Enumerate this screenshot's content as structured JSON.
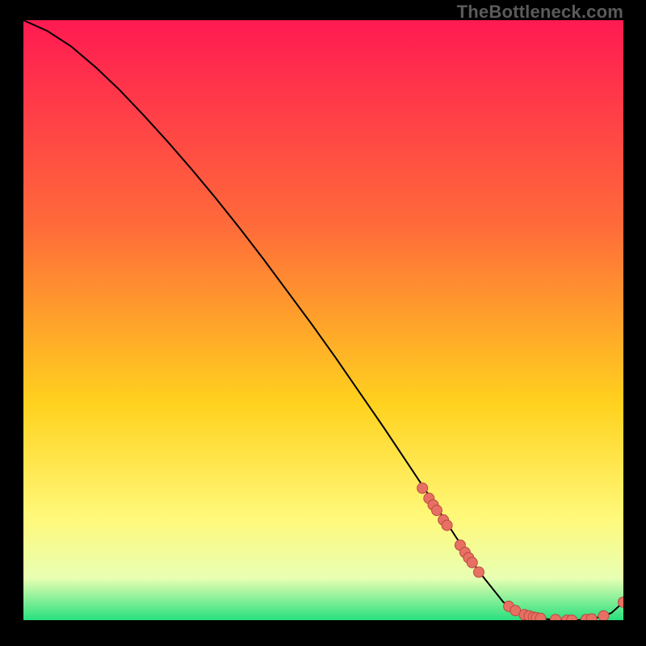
{
  "watermark": "TheBottleneck.com",
  "colors": {
    "black": "#000000",
    "gradient_top": "#ff1a52",
    "gradient_mid1": "#ff6a3a",
    "gradient_mid2": "#ffd21e",
    "gradient_mid3": "#fff97a",
    "gradient_mid4": "#e8ffb3",
    "gradient_bottom": "#28e07f",
    "line": "#000000",
    "point_fill": "#e77063",
    "point_stroke": "#b84b42"
  },
  "chart_data": {
    "type": "line",
    "title": "",
    "xlabel": "",
    "ylabel": "",
    "xlim": [
      0,
      100
    ],
    "ylim": [
      0,
      100
    ],
    "series": [
      {
        "name": "curve",
        "x": [
          0,
          4,
          8,
          12,
          16,
          20,
          24,
          28,
          32,
          36,
          40,
          44,
          48,
          52,
          56,
          60,
          64,
          68,
          72,
          76,
          80,
          83,
          86,
          88,
          90,
          92,
          94,
          96,
          98,
          100
        ],
        "y": [
          100,
          98.2,
          95.6,
          92.2,
          88.4,
          84.2,
          79.8,
          75.2,
          70.4,
          65.4,
          60.2,
          54.8,
          49.4,
          43.8,
          38.0,
          32.2,
          26.2,
          20.2,
          14.0,
          8.0,
          3.0,
          1.2,
          0.3,
          0.1,
          0.0,
          0.0,
          0.1,
          0.5,
          1.2,
          3.0
        ]
      }
    ],
    "points": [
      {
        "x": 66.5,
        "y": 22.0
      },
      {
        "x": 67.6,
        "y": 20.3
      },
      {
        "x": 68.3,
        "y": 19.2
      },
      {
        "x": 68.9,
        "y": 18.3
      },
      {
        "x": 70.0,
        "y": 16.7
      },
      {
        "x": 70.6,
        "y": 15.8
      },
      {
        "x": 72.8,
        "y": 12.5
      },
      {
        "x": 73.6,
        "y": 11.3
      },
      {
        "x": 74.2,
        "y": 10.4
      },
      {
        "x": 74.8,
        "y": 9.6
      },
      {
        "x": 75.9,
        "y": 8.0
      },
      {
        "x": 80.9,
        "y": 2.3
      },
      {
        "x": 82.0,
        "y": 1.6
      },
      {
        "x": 83.5,
        "y": 0.9
      },
      {
        "x": 84.3,
        "y": 0.7
      },
      {
        "x": 85.0,
        "y": 0.5
      },
      {
        "x": 85.5,
        "y": 0.4
      },
      {
        "x": 86.2,
        "y": 0.3
      },
      {
        "x": 88.7,
        "y": 0.1
      },
      {
        "x": 90.6,
        "y": 0.0
      },
      {
        "x": 91.4,
        "y": 0.0
      },
      {
        "x": 93.8,
        "y": 0.1
      },
      {
        "x": 94.7,
        "y": 0.2
      },
      {
        "x": 96.7,
        "y": 0.7
      },
      {
        "x": 100.0,
        "y": 3.0
      }
    ]
  }
}
